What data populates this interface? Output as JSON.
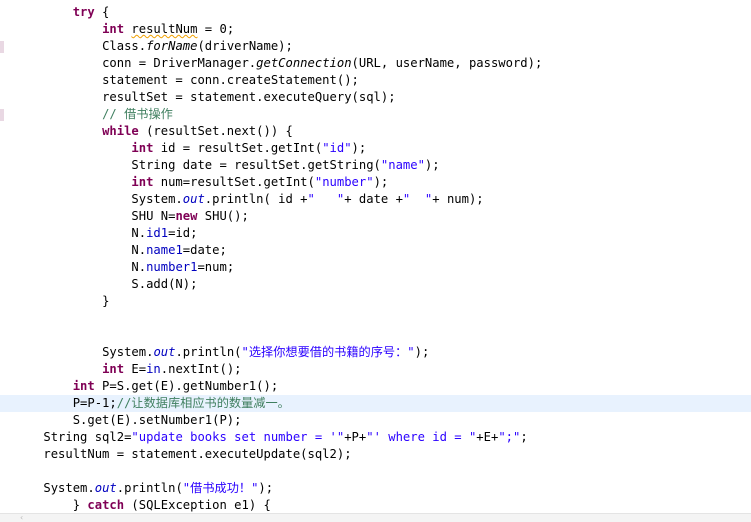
{
  "editor": {
    "lines": [
      {
        "indent": "        ",
        "segs": [
          {
            "t": "try",
            "c": "kw"
          },
          {
            "t": " {"
          }
        ]
      },
      {
        "indent": "            ",
        "segs": [
          {
            "t": "int",
            "c": "kw"
          },
          {
            "t": " "
          },
          {
            "t": "resultNum",
            "c": "warn"
          },
          {
            "t": " = 0;"
          }
        ]
      },
      {
        "indent": "            ",
        "segs": [
          {
            "t": "Class."
          },
          {
            "t": "forName",
            "c": "it"
          },
          {
            "t": "(driverName);"
          }
        ]
      },
      {
        "indent": "            ",
        "segs": [
          {
            "t": "conn = DriverManager."
          },
          {
            "t": "getConnection",
            "c": "it"
          },
          {
            "t": "(URL, userName, password);"
          }
        ]
      },
      {
        "indent": "            ",
        "segs": [
          {
            "t": "statement = conn.createStatement();"
          }
        ]
      },
      {
        "indent": "            ",
        "segs": [
          {
            "t": "resultSet = statement.executeQuery(sql);"
          }
        ]
      },
      {
        "indent": "            ",
        "segs": [
          {
            "t": "// 借书操作",
            "c": "cm"
          }
        ]
      },
      {
        "indent": "            ",
        "segs": [
          {
            "t": "while",
            "c": "kw"
          },
          {
            "t": " (resultSet.next()) {"
          }
        ]
      },
      {
        "indent": "                ",
        "segs": [
          {
            "t": "int",
            "c": "kw"
          },
          {
            "t": " id = resultSet.getInt("
          },
          {
            "t": "\"id\"",
            "c": "str"
          },
          {
            "t": ");"
          }
        ]
      },
      {
        "indent": "                ",
        "segs": [
          {
            "t": "String date = resultSet.getString("
          },
          {
            "t": "\"name\"",
            "c": "str"
          },
          {
            "t": ");"
          }
        ]
      },
      {
        "indent": "                ",
        "segs": [
          {
            "t": "int",
            "c": "kw"
          },
          {
            "t": " num=resultSet.getInt("
          },
          {
            "t": "\"number\"",
            "c": "str"
          },
          {
            "t": ");"
          }
        ]
      },
      {
        "indent": "                ",
        "segs": [
          {
            "t": "System."
          },
          {
            "t": "out",
            "c": "var it"
          },
          {
            "t": ".println( id +"
          },
          {
            "t": "\"   \"",
            "c": "str"
          },
          {
            "t": "+ date +"
          },
          {
            "t": "\"  \"",
            "c": "str"
          },
          {
            "t": "+ num);"
          }
        ]
      },
      {
        "indent": "                ",
        "segs": [
          {
            "t": "SHU N="
          },
          {
            "t": "new",
            "c": "kw"
          },
          {
            "t": " SHU();"
          }
        ]
      },
      {
        "indent": "                ",
        "segs": [
          {
            "t": "N."
          },
          {
            "t": "id1",
            "c": "var"
          },
          {
            "t": "=id;"
          }
        ]
      },
      {
        "indent": "                ",
        "segs": [
          {
            "t": "N."
          },
          {
            "t": "name1",
            "c": "var"
          },
          {
            "t": "=date;"
          }
        ]
      },
      {
        "indent": "                ",
        "segs": [
          {
            "t": "N."
          },
          {
            "t": "number1",
            "c": "var"
          },
          {
            "t": "=num;"
          }
        ]
      },
      {
        "indent": "                ",
        "segs": [
          {
            "t": "S.add(N);"
          }
        ]
      },
      {
        "indent": "            ",
        "segs": [
          {
            "t": "}"
          }
        ]
      },
      {
        "indent": "",
        "segs": []
      },
      {
        "indent": "",
        "segs": []
      },
      {
        "indent": "            ",
        "segs": [
          {
            "t": "System."
          },
          {
            "t": "out",
            "c": "var it"
          },
          {
            "t": ".println("
          },
          {
            "t": "\"选择你想要借的书籍的序号：\"",
            "c": "str"
          },
          {
            "t": ");"
          }
        ]
      },
      {
        "indent": "            ",
        "segs": [
          {
            "t": "int",
            "c": "kw"
          },
          {
            "t": " E="
          },
          {
            "t": "in",
            "c": "var"
          },
          {
            "t": ".nextInt();"
          }
        ]
      },
      {
        "indent": "        ",
        "segs": [
          {
            "t": "int",
            "c": "kw"
          },
          {
            "t": " P=S.get(E).getNumber1();"
          }
        ]
      },
      {
        "indent": "        ",
        "segs": [
          {
            "t": "P=P-1;"
          },
          {
            "t": "//让数据库相应书的数量减一。",
            "c": "cm"
          }
        ],
        "current": true
      },
      {
        "indent": "        ",
        "segs": [
          {
            "t": "S.get(E).setNumber1(P);"
          }
        ]
      },
      {
        "indent": "    ",
        "segs": [
          {
            "t": "String sql2="
          },
          {
            "t": "\"update books set number = '\"",
            "c": "str"
          },
          {
            "t": "+P+"
          },
          {
            "t": "\"' where id = \"",
            "c": "str"
          },
          {
            "t": "+E+"
          },
          {
            "t": "\";\"",
            "c": "str"
          },
          {
            "t": ";"
          }
        ]
      },
      {
        "indent": "    ",
        "segs": [
          {
            "t": "resultNum = statement.executeUpdate(sql2);"
          }
        ]
      },
      {
        "indent": "",
        "segs": []
      },
      {
        "indent": "    ",
        "segs": [
          {
            "t": "System."
          },
          {
            "t": "out",
            "c": "var it"
          },
          {
            "t": ".println("
          },
          {
            "t": "\"借书成功！\"",
            "c": "str"
          },
          {
            "t": ");"
          }
        ]
      },
      {
        "indent": "        ",
        "segs": [
          {
            "t": "} "
          },
          {
            "t": "catch",
            "c": "kw"
          },
          {
            "t": " (SQLException e1) {"
          }
        ]
      }
    ],
    "markers": [
      2,
      6,
      23
    ]
  }
}
